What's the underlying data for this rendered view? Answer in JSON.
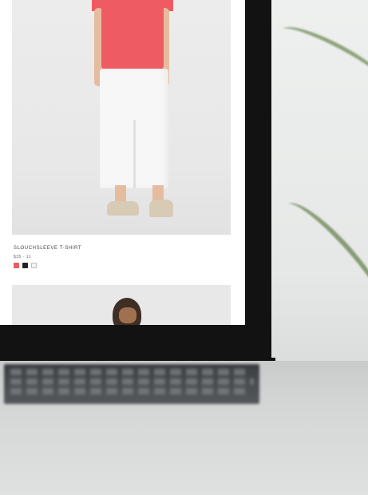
{
  "scene": {
    "description_tags": [
      "laptop",
      "product-listing",
      "plant"
    ]
  },
  "product": {
    "name": "SLOUCHSLEEVE T-SHIRT",
    "price": "$35  ·  11",
    "swatch_colors": [
      "#ef5b62",
      "#222222",
      "#f3f3f3"
    ]
  }
}
